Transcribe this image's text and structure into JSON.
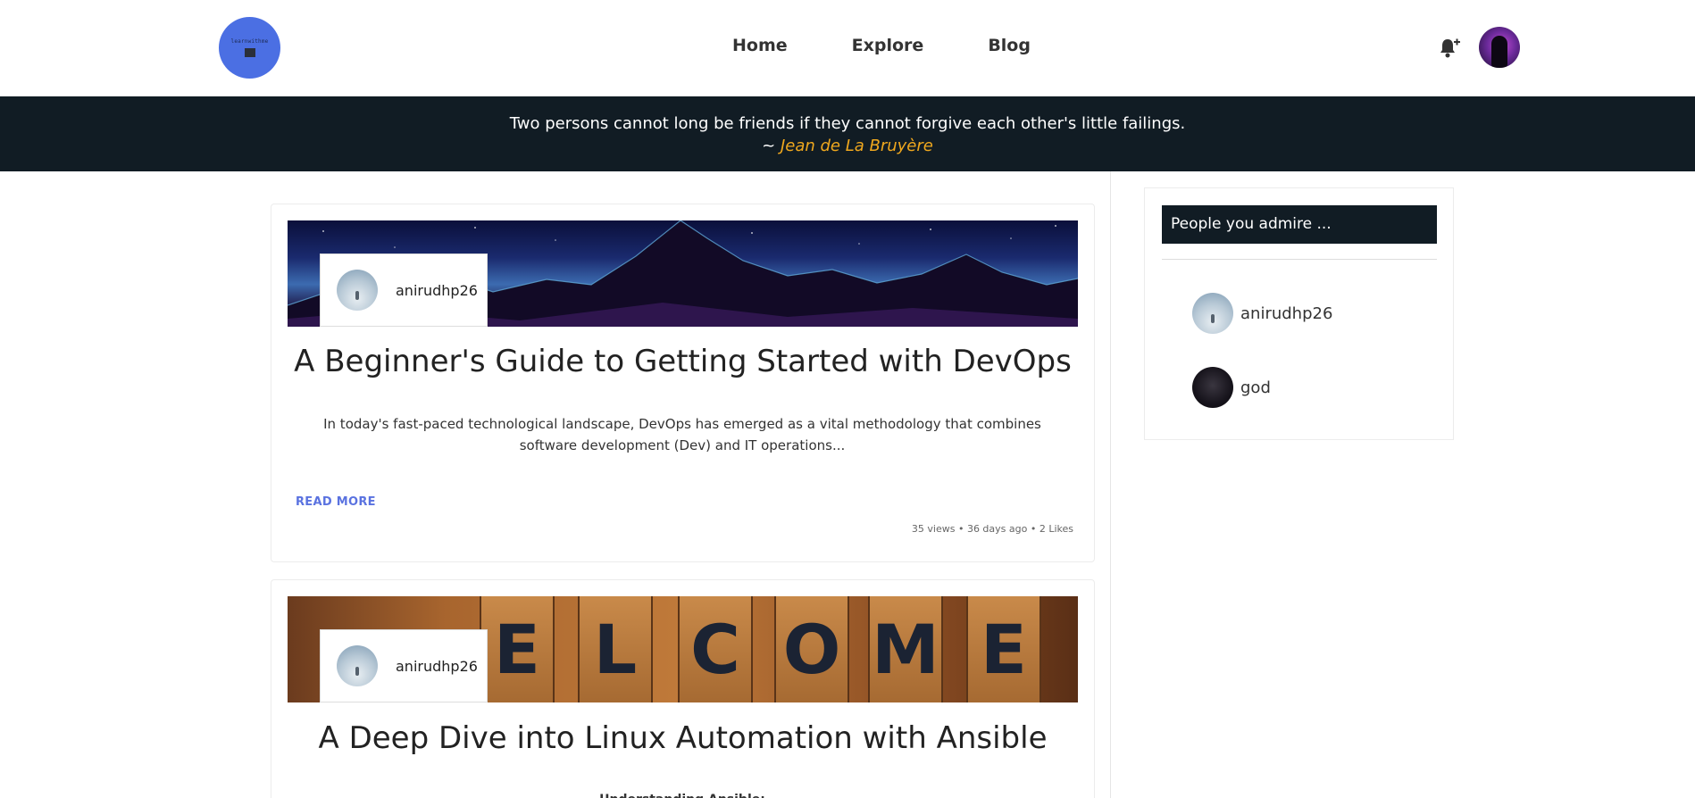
{
  "header": {
    "logo_text": "learnwithme",
    "nav": [
      {
        "label": "Home"
      },
      {
        "label": "Explore"
      },
      {
        "label": "Blog"
      }
    ],
    "notification_icon": "bell-plus-icon",
    "profile_avatar": "user-avatar"
  },
  "quote": {
    "text": "Two persons cannot long be friends if they cannot forgive each other's little failings.",
    "prefix": "~ ",
    "author": "Jean de La Bruyère",
    "author_color": "#f0a81e"
  },
  "posts": [
    {
      "author": "anirudhp26",
      "title": "A Beginner's Guide to Getting Started with DevOps",
      "excerpt": "In today's fast-paced technological landscape, DevOps has emerged as a vital methodology that combines software development (Dev) and IT operations...",
      "read_more": "READ MORE",
      "meta": "35 views • 36 days ago • 2 Likes"
    },
    {
      "author": "anirudhp26",
      "title": "A Deep Dive into Linux Automation with Ansible",
      "excerpt": "Understanding Ansible:",
      "cover_letters": [
        "E",
        "L",
        "C",
        "O",
        "M",
        "E"
      ]
    }
  ],
  "sidebar": {
    "title": "People you admire ...",
    "people": [
      {
        "name": "anirudhp26"
      },
      {
        "name": "god"
      }
    ]
  },
  "colors": {
    "dark_bar": "#111c24",
    "accent_link": "#5a72e0",
    "logo_bg": "#4b6fe3"
  }
}
